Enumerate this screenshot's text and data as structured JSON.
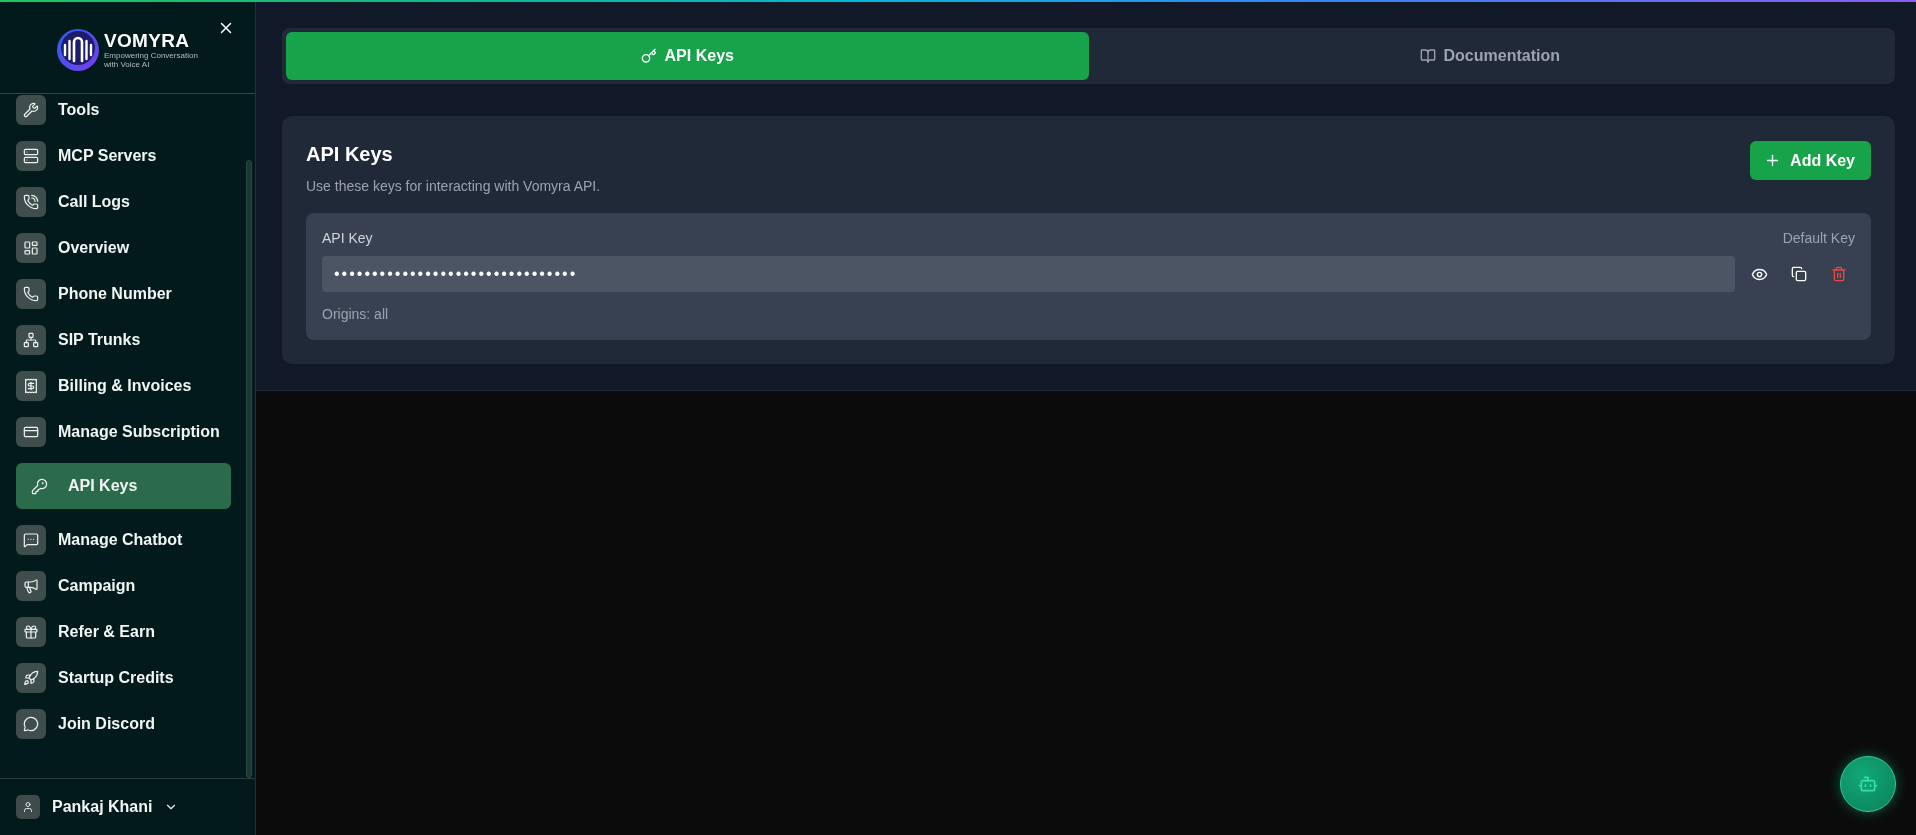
{
  "sidebar": {
    "logo": {
      "name": "VOMYRA",
      "tagline": "Empowering Conversation with Voice AI"
    },
    "items": [
      {
        "label": "Tools",
        "selected": false
      },
      {
        "label": "MCP Servers",
        "selected": false
      },
      {
        "label": "Call Logs",
        "selected": false
      },
      {
        "label": "Overview",
        "selected": false
      },
      {
        "label": "Phone Number",
        "selected": false
      },
      {
        "label": "SIP Trunks",
        "selected": false
      },
      {
        "label": "Billing & Invoices",
        "selected": false
      },
      {
        "label": "Manage Subscription",
        "selected": false
      },
      {
        "label": "API Keys",
        "selected": true
      },
      {
        "label": "Manage Chatbot",
        "selected": false
      },
      {
        "label": "Campaign",
        "selected": false
      },
      {
        "label": "Refer & Earn",
        "selected": false
      },
      {
        "label": "Startup Credits",
        "selected": false
      },
      {
        "label": "Join Discord",
        "selected": false
      }
    ],
    "user": {
      "name": "Pankaj Khani"
    }
  },
  "tabs": [
    {
      "label": "API Keys",
      "selected": true
    },
    {
      "label": "Documentation",
      "selected": false
    }
  ],
  "api_keys": {
    "title": "API Keys",
    "subtitle": "Use these keys for interacting with Vomyra API.",
    "add_button": "Add Key",
    "keys": [
      {
        "label": "API Key",
        "badge": "Default Key",
        "value": "••••••••••••••••••••••••••••••••",
        "origins": "Origins: all"
      }
    ]
  }
}
